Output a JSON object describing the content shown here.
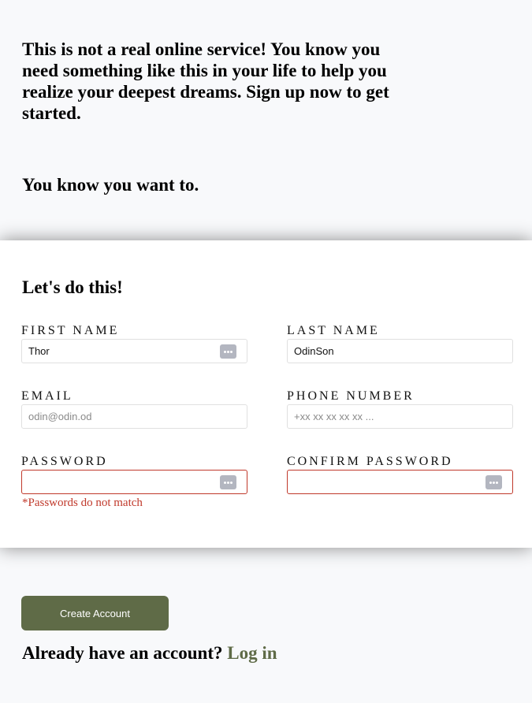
{
  "intro": {
    "paragraph": "This is not a real online service! You know you need something like this in your life to help you realize your deepest dreams. Sign up now to get started.",
    "tagline": "You know you want to."
  },
  "form": {
    "heading": "Let's do this!",
    "fields": {
      "first_name": {
        "label": "FIRST NAME",
        "value": "Thor",
        "placeholder": ""
      },
      "last_name": {
        "label": "LAST NAME",
        "value": "OdinSon",
        "placeholder": ""
      },
      "email": {
        "label": "EMAIL",
        "value": "",
        "placeholder": "odin@odin.od"
      },
      "phone": {
        "label": "PHONE NUMBER",
        "value": "",
        "placeholder": "+xx xx xx xx xx ..."
      },
      "password": {
        "label": "PASSWORD",
        "value": "",
        "placeholder": ""
      },
      "confirm_password": {
        "label": "CONFIRM PASSWORD",
        "value": "",
        "placeholder": ""
      }
    },
    "error_message": "*Passwords do not match",
    "icons": {
      "autofill": "password-manager-icon"
    }
  },
  "actions": {
    "create_account": "Create Account",
    "login_prompt": "Already have an account?",
    "login_link": "Log in"
  },
  "colors": {
    "page_background": "#f8f9fb",
    "accent": "#5f6b47",
    "error": "#c0392b"
  }
}
